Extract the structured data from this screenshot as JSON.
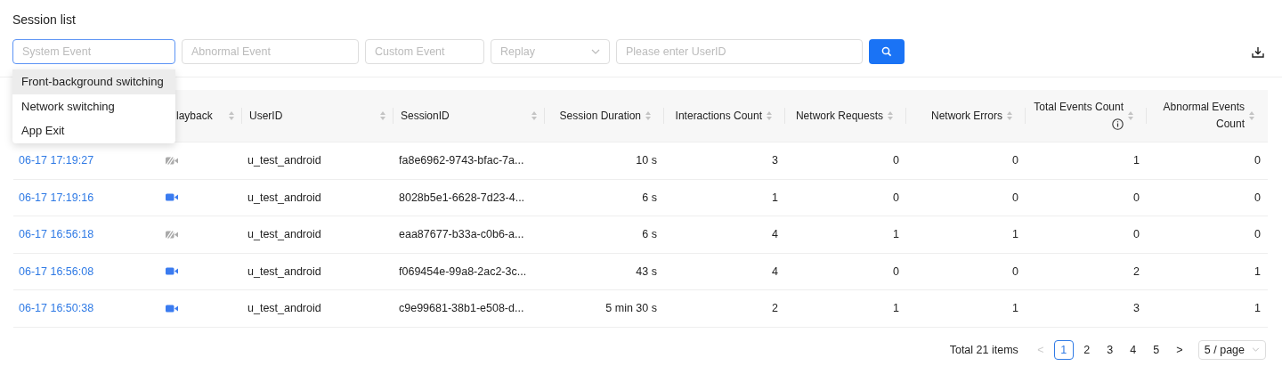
{
  "title": "Session list",
  "filters": {
    "system_event": {
      "placeholder": "System Event",
      "focused": true
    },
    "abnormal_event": {
      "placeholder": "Abnormal Event"
    },
    "custom_event": {
      "placeholder": "Custom Event"
    },
    "replay": {
      "placeholder": "Replay"
    },
    "user_id": {
      "placeholder": "Please enter UserID"
    }
  },
  "dropdown": {
    "items": [
      {
        "label": "Front-background switching",
        "selected": true
      },
      {
        "label": "Network switching",
        "selected": false
      },
      {
        "label": "App Exit",
        "selected": false
      }
    ]
  },
  "table": {
    "columns": [
      {},
      {
        "label": "layback"
      },
      {
        "label": "UserID"
      },
      {
        "label": "SessionID"
      },
      {
        "label": "Session Duration"
      },
      {
        "label": "Interactions Count"
      },
      {
        "label": "Network Requests"
      },
      {
        "label": "Network Errors"
      },
      {
        "label": "Total Events Count",
        "info": true
      },
      {
        "label": "Abnormal Events Count"
      }
    ],
    "rows": [
      {
        "time": "06-17 17:19:27",
        "playback": false,
        "user": "u_test_android",
        "session": "fa8e6962-9743-bfac-7a...",
        "duration": "10 s",
        "interactions": "3",
        "requests": "0",
        "errors": "0",
        "total": "1",
        "abnormal": "0"
      },
      {
        "time": "06-17 17:19:16",
        "playback": true,
        "user": "u_test_android",
        "session": "8028b5e1-6628-7d23-4...",
        "duration": "6 s",
        "interactions": "1",
        "requests": "0",
        "errors": "0",
        "total": "0",
        "abnormal": "0"
      },
      {
        "time": "06-17 16:56:18",
        "playback": false,
        "user": "u_test_android",
        "session": "eaa87677-b33a-c0b6-a...",
        "duration": "6 s",
        "interactions": "4",
        "requests": "1",
        "errors": "1",
        "total": "0",
        "abnormal": "0"
      },
      {
        "time": "06-17 16:56:08",
        "playback": true,
        "user": "u_test_android",
        "session": "f069454e-99a8-2ac2-3c...",
        "duration": "43 s",
        "interactions": "4",
        "requests": "0",
        "errors": "0",
        "total": "2",
        "abnormal": "1"
      },
      {
        "time": "06-17 16:50:38",
        "playback": true,
        "user": "u_test_android",
        "session": "c9e99681-38b1-e508-d...",
        "duration": "5 min 30 s",
        "interactions": "2",
        "requests": "1",
        "errors": "1",
        "total": "3",
        "abnormal": "1"
      }
    ]
  },
  "pagination": {
    "total": "Total 21 items",
    "prev": "<",
    "next": ">",
    "pages": [
      {
        "label": "1",
        "selected": true
      },
      {
        "label": "2",
        "selected": false
      },
      {
        "label": "3",
        "selected": false
      },
      {
        "label": "4",
        "selected": false
      },
      {
        "label": "5",
        "selected": false
      }
    ],
    "page_size": "5 / page"
  }
}
